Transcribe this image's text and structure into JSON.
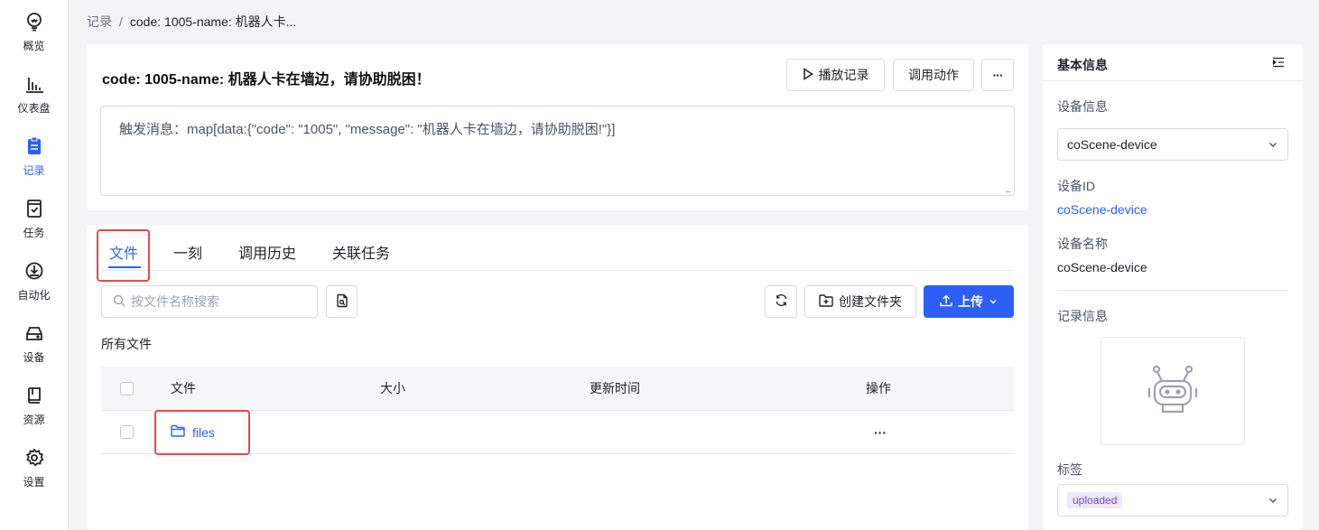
{
  "nav": {
    "items": [
      {
        "label": "概览",
        "icon": "lightbulb-icon"
      },
      {
        "label": "仪表盘",
        "icon": "bar-chart-icon"
      },
      {
        "label": "记录",
        "icon": "record-icon",
        "active": true
      },
      {
        "label": "任务",
        "icon": "task-icon"
      },
      {
        "label": "自动化",
        "icon": "automation-icon"
      },
      {
        "label": "设备",
        "icon": "device-icon"
      },
      {
        "label": "资源",
        "icon": "book-icon"
      },
      {
        "label": "设置",
        "icon": "gear-icon"
      }
    ]
  },
  "breadcrumb": {
    "root": "记录",
    "separator": "/",
    "current": "code: 1005-name: 机器人卡..."
  },
  "record": {
    "title": "code: 1005-name: 机器人卡在墙边，请协助脱困！",
    "play_label": "播放记录",
    "invoke_label": "调用动作",
    "more_label": "···",
    "message": "触发消息：map[data:{\"code\": \"1005\", \"message\": \"机器人卡在墙边，请协助脱困!\"}]"
  },
  "tabs": [
    "文件",
    "一刻",
    "调用历史",
    "关联任务"
  ],
  "files": {
    "search_placeholder": "按文件名称搜索",
    "create_folder_label": "创建文件夹",
    "upload_label": "上传",
    "section_title": "所有文件",
    "columns": [
      "文件",
      "大小",
      "更新时间",
      "操作"
    ],
    "rows": [
      {
        "name": "files",
        "size": "",
        "updated": "",
        "action": "···"
      }
    ]
  },
  "side": {
    "title": "基本信息",
    "device_info_label": "设备信息",
    "device_select": "coScene-device",
    "device_id_label": "设备ID",
    "device_id": "coScene-device",
    "device_name_label": "设备名称",
    "device_name": "coScene-device",
    "record_info_label": "记录信息",
    "tags_label": "标签",
    "tag": "uploaded"
  },
  "colors": {
    "accent": "#2b5ff5",
    "highlight": "#e24b4b",
    "tag_bg": "#f0e8ff",
    "tag_text": "#7a3fd1"
  }
}
